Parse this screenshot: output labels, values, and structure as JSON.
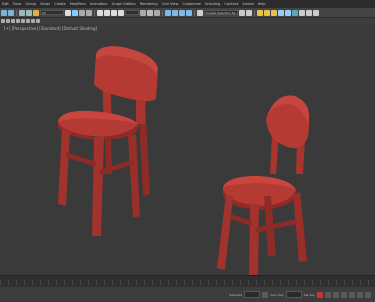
{
  "menu": [
    "Edit",
    "Tools",
    "Group",
    "Views",
    "Create",
    "Modifiers",
    "Animation",
    "Graph Editors",
    "Rendering",
    "Civil View",
    "Customize",
    "Scripting",
    "Content",
    "Arnold",
    "Help"
  ],
  "toolbar": {
    "selection_filter": "All",
    "named_selection": "Create Selection Se"
  },
  "viewport": {
    "label": "[+] [Perspective] [Standard] [Default Shading]"
  },
  "status": {
    "text1": "Selected",
    "text2": "Auto Key",
    "text3": "Set Key"
  },
  "colors": {
    "chair": "#b53a33",
    "viewport_bg": "#3a3a3a",
    "ui_dark": "#2b2b2b"
  }
}
